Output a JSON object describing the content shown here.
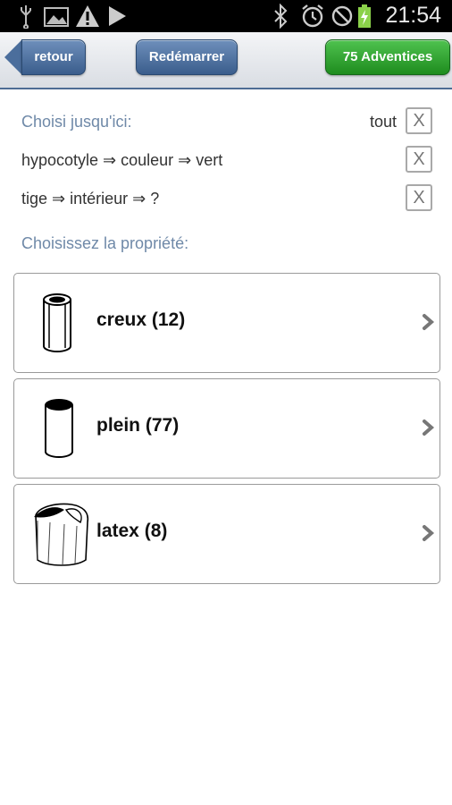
{
  "status_bar": {
    "time": "21:54",
    "icons": [
      "usb-icon",
      "image-icon",
      "warning-icon",
      "play-icon",
      "bluetooth-icon",
      "alarm-icon",
      "no-signal-icon",
      "battery-charging-icon"
    ]
  },
  "header": {
    "back_label": "retour",
    "restart_label": "Redémarrer",
    "count_label": "75 Adventices"
  },
  "chosen": {
    "heading": "Choisi jusqu'ici:",
    "clear_all_label": "tout",
    "items": [
      {
        "label": "hypocotyle ⇒ couleur ⇒ vert"
      },
      {
        "label": "tige ⇒ intérieur ⇒ ?"
      }
    ],
    "remove_label": "X"
  },
  "choose_heading": "Choisissez la propriété:",
  "options": [
    {
      "label": "creux (12)",
      "icon": "hollow-stem-icon"
    },
    {
      "label": "plein (77)",
      "icon": "solid-stem-icon"
    },
    {
      "label": "latex (8)",
      "icon": "latex-stem-icon"
    }
  ],
  "colors": {
    "accent_blue": "#3a5d8c",
    "accent_green": "#1e8c1e",
    "heading_blue": "#6f89a8"
  }
}
